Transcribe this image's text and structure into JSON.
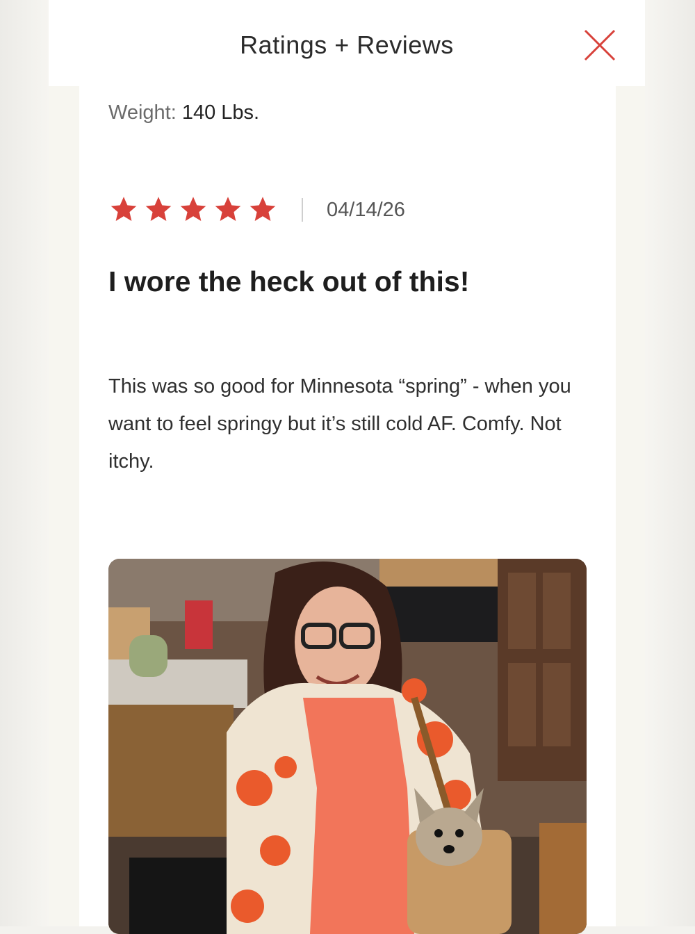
{
  "header": {
    "title": "Ratings + Reviews",
    "close_icon": "close-icon"
  },
  "review": {
    "weight_label": "Weight:",
    "weight_value": "140 Lbs.",
    "rating": 5,
    "rating_max": 5,
    "star_color": "#d8413a",
    "date": "04/14/26",
    "title": "I wore the heck out of this!",
    "body": "This was so good for Minnesota “spring” - when you want to feel springy but it’s still cold AF. Comfy. Not itchy."
  },
  "colors": {
    "accent": "#d8413a"
  }
}
